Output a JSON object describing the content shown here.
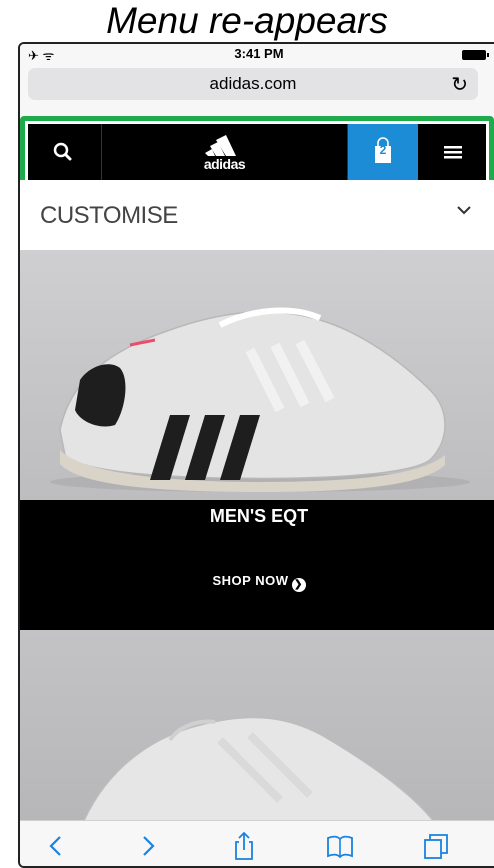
{
  "caption": "Menu re-appears",
  "status": {
    "signal": "✈ ᯤ",
    "time": "3:41 PM"
  },
  "browser": {
    "url": "adidas.com",
    "reload_glyph": "↻"
  },
  "nav": {
    "logo": "adidas",
    "bag_count": "2",
    "highlight_color": "#1faa4c",
    "bag_color": "#1c8cd6"
  },
  "customise": {
    "label": "CUSTOMISE"
  },
  "promo": {
    "title": "MEN'S EQT",
    "cta": "SHOP NOW",
    "cta_icon": "❯"
  },
  "toolbar": {
    "back": "back-icon",
    "forward": "forward-icon",
    "share": "share-icon",
    "bookmarks": "bookmarks-icon",
    "tabs": "tabs-icon"
  }
}
